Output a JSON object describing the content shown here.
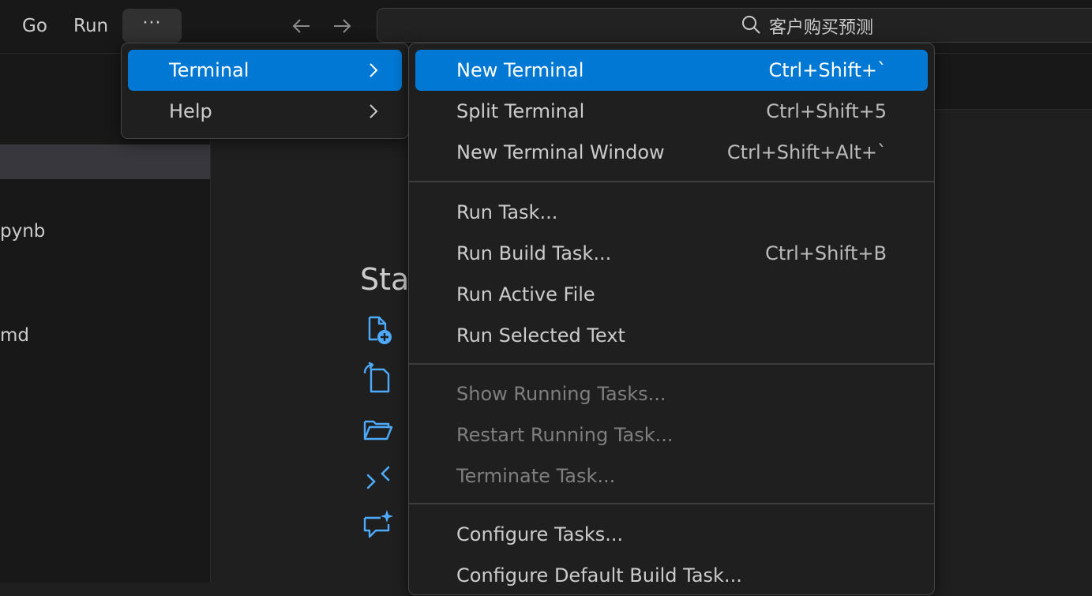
{
  "titlebar": {
    "menus": [
      "Go",
      "Run"
    ],
    "more_label": "···",
    "search_text": "客户购买预测"
  },
  "sidebar": {
    "files": [
      "pynb",
      "md"
    ]
  },
  "editor": {
    "start_heading": "Star"
  },
  "menubar_overflow": {
    "items": [
      {
        "label": "Terminal",
        "active": true
      },
      {
        "label": "Help",
        "active": false
      }
    ]
  },
  "terminal_menu": {
    "groups": [
      [
        {
          "label": "New Terminal",
          "shortcut": "Ctrl+Shift+`",
          "active": true
        },
        {
          "label": "Split Terminal",
          "shortcut": "Ctrl+Shift+5"
        },
        {
          "label": "New Terminal Window",
          "shortcut": "Ctrl+Shift+Alt+`"
        }
      ],
      [
        {
          "label": "Run Task...",
          "shortcut": ""
        },
        {
          "label": "Run Build Task...",
          "shortcut": "Ctrl+Shift+B"
        },
        {
          "label": "Run Active File",
          "shortcut": ""
        },
        {
          "label": "Run Selected Text",
          "shortcut": ""
        }
      ],
      [
        {
          "label": "Show Running Tasks...",
          "shortcut": "",
          "disabled": true
        },
        {
          "label": "Restart Running Task...",
          "shortcut": "",
          "disabled": true
        },
        {
          "label": "Terminate Task...",
          "shortcut": "",
          "disabled": true
        }
      ],
      [
        {
          "label": "Configure Tasks...",
          "shortcut": ""
        },
        {
          "label": "Configure Default Build Task...",
          "shortcut": ""
        }
      ]
    ]
  },
  "colors": {
    "accent": "#0078d4",
    "icon_blue": "#4daafc",
    "background": "#1f1f1f"
  },
  "icons": [
    "back-arrow-icon",
    "forward-arrow-icon",
    "search-icon",
    "chevron-right-icon",
    "new-file-icon",
    "open-file-icon",
    "open-folder-icon",
    "remote-connect-icon",
    "chat-sparkle-icon"
  ]
}
